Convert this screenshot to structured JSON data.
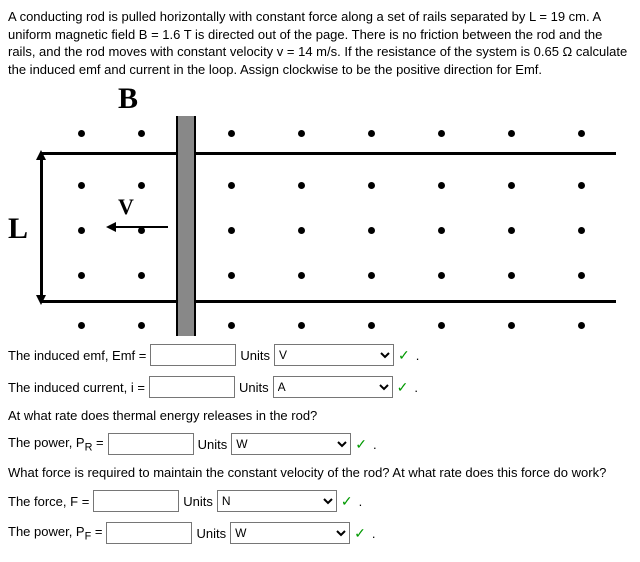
{
  "problem": "A conducting rod is pulled horizontally with constant force along a set of rails separated by L = 19 cm. A uniform magnetic field B = 1.6 T is directed out of the page. There is no friction between the rod and the rails, and the rod moves with constant velocity v = 14 m/s. If the resistance of the system is 0.65 Ω calculate the induced emf and current in the loop. Assign clockwise to be the positive direction for Emf.",
  "labels": {
    "B": "B",
    "L": "L",
    "V": "V"
  },
  "rows": {
    "emf": {
      "label": "The induced emf, Emf =",
      "units_label": "Units",
      "unit": "V"
    },
    "current": {
      "label": "The induced current, i =",
      "units_label": "Units",
      "unit": "A"
    },
    "q_thermal": "At what rate does thermal energy releases in the rod?",
    "pr": {
      "label": "The power, P",
      "sub": "R",
      "eq": " =",
      "units_label": "Units",
      "unit": "W"
    },
    "q_force": "What force is required to maintain the constant velocity of the rod? At what rate does this force do work?",
    "force": {
      "label": "The force, F =",
      "units_label": "Units",
      "unit": "N"
    },
    "pf": {
      "label": "The power, P",
      "sub": "F",
      "eq": " =",
      "units_label": "Units",
      "unit": "W"
    }
  }
}
